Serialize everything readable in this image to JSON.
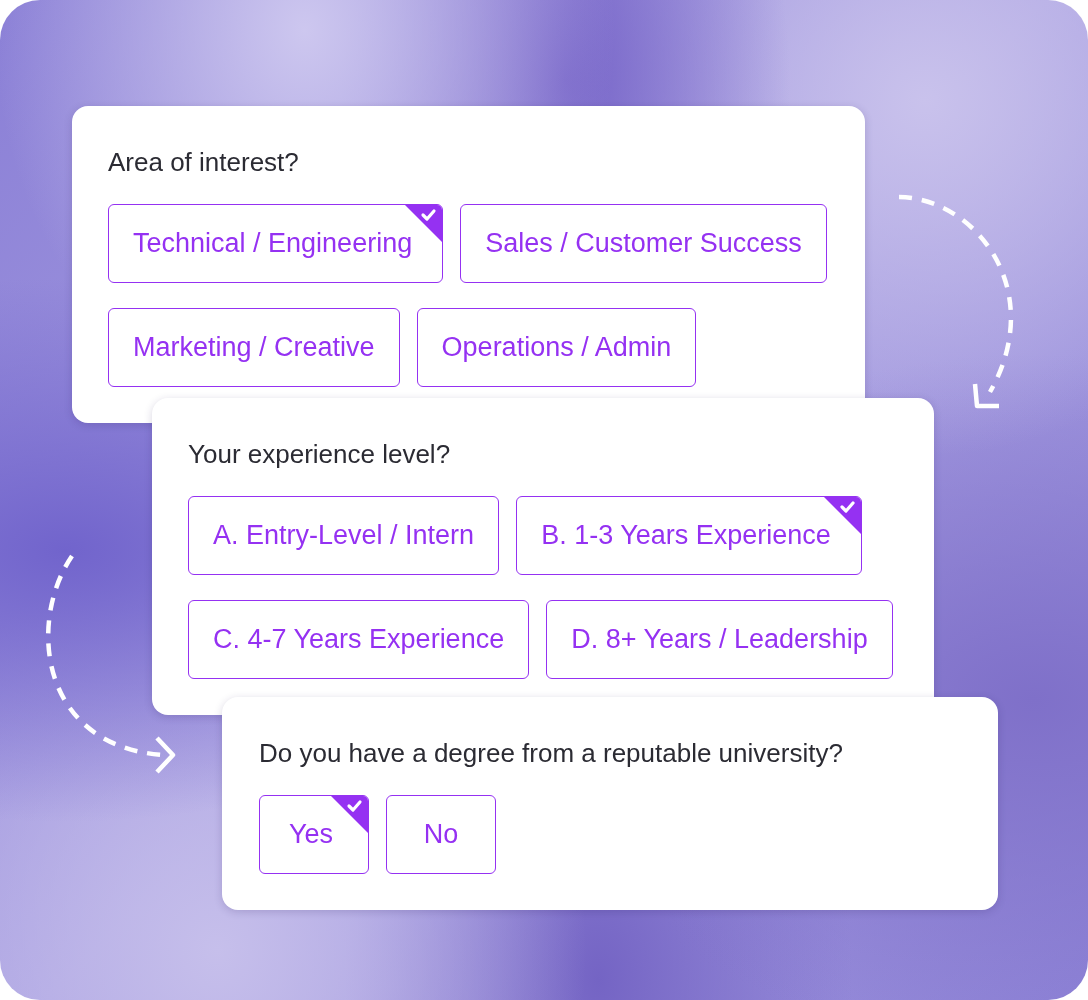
{
  "questions": [
    {
      "prompt": "Area of interest?",
      "options": [
        {
          "label": "Technical / Engineering",
          "selected": true
        },
        {
          "label": "Sales / Customer Success",
          "selected": false
        },
        {
          "label": "Marketing / Creative",
          "selected": false
        },
        {
          "label": "Operations / Admin",
          "selected": false
        }
      ]
    },
    {
      "prompt": "Your experience level?",
      "options": [
        {
          "label": "A. Entry-Level / Intern",
          "selected": false
        },
        {
          "label": "B. 1-3 Years Experience",
          "selected": true
        },
        {
          "label": "C. 4-7 Years Experience",
          "selected": false
        },
        {
          "label": "D. 8+ Years / Leadership",
          "selected": false
        }
      ]
    },
    {
      "prompt": "Do you have a degree from a reputable university?",
      "options": [
        {
          "label": "Yes",
          "selected": true
        },
        {
          "label": "No",
          "selected": false
        }
      ]
    }
  ]
}
